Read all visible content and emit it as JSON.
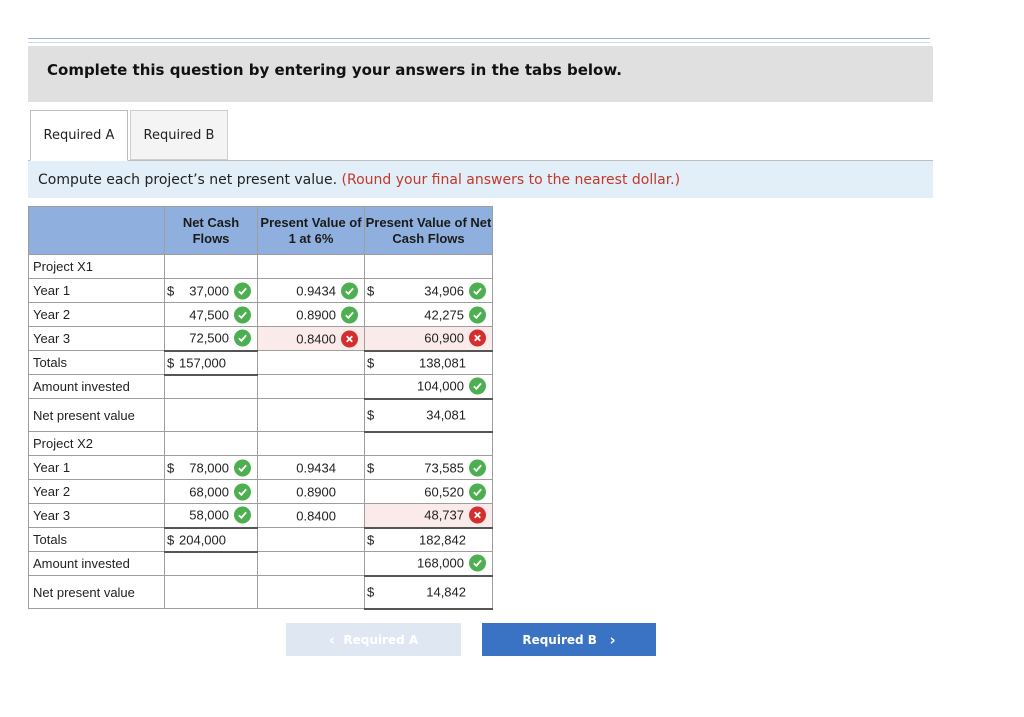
{
  "banner": {
    "text": "Complete this question by entering your answers in the tabs below."
  },
  "tabs": [
    {
      "label": "Required A",
      "active": true
    },
    {
      "label": "Required B",
      "active": false
    }
  ],
  "instruction": {
    "text": "Compute each project’s net present value.",
    "note": "(Round your final answers to the nearest dollar.)"
  },
  "table": {
    "headers": [
      "",
      "Net Cash Flows",
      "Present Value of 1 at 6%",
      "Present Value of Net Cash Flows"
    ],
    "currency": "$",
    "x1": {
      "title": "Project X1",
      "rows": [
        {
          "label": "Year 1",
          "cash": "37,000",
          "cash_mark": "correct",
          "factor": "0.9434",
          "factor_mark": "correct",
          "pv": "34,906",
          "pv_mark": "correct"
        },
        {
          "label": "Year 2",
          "cash": "47,500",
          "cash_mark": "correct",
          "factor": "0.8900",
          "factor_mark": "correct",
          "pv": "42,275",
          "pv_mark": "correct"
        },
        {
          "label": "Year 3",
          "cash": "72,500",
          "cash_mark": "correct",
          "factor": "0.8400",
          "factor_mark": "incorrect",
          "pv": "60,900",
          "pv_mark": "incorrect"
        }
      ],
      "totals_label": "Totals",
      "totals_cash": "157,000",
      "totals_pv": "138,081",
      "invested_label": "Amount invested",
      "invested_pv": "104,000",
      "npv_label": "Net present value",
      "npv_pv": "34,081"
    },
    "x2": {
      "title": "Project X2",
      "rows": [
        {
          "label": "Year 1",
          "cash": "78,000",
          "cash_mark": "correct",
          "factor": "0.9434",
          "pv": "73,585",
          "pv_mark": "correct"
        },
        {
          "label": "Year 2",
          "cash": "68,000",
          "cash_mark": "correct",
          "factor": "0.8900",
          "pv": "60,520",
          "pv_mark": "correct"
        },
        {
          "label": "Year 3",
          "cash": "58,000",
          "cash_mark": "correct",
          "factor": "0.8400",
          "pv": "48,737",
          "pv_mark": "incorrect"
        }
      ],
      "totals_label": "Totals",
      "totals_cash": "204,000",
      "totals_pv": "182,842",
      "invested_label": "Amount invested",
      "invested_pv": "168,000",
      "npv_label": "Net present value",
      "npv_pv": "14,842"
    }
  },
  "nav": {
    "prev_label": "Required A",
    "prev_icon": "chevron-left-icon",
    "next_label": "Required B",
    "next_icon": "chevron-right-icon"
  },
  "colors": {
    "header_blue": "#8fb0de",
    "correct_green": "#4caf50",
    "incorrect_red": "#d32f2f",
    "next_button": "#3a73c3",
    "instruction_note": "#c0392b"
  }
}
